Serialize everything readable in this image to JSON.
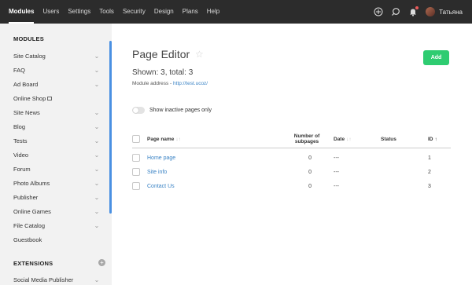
{
  "topnav": {
    "items": [
      "Modules",
      "Users",
      "Settings",
      "Tools",
      "Security",
      "Design",
      "Plans",
      "Help"
    ],
    "active_index": 0
  },
  "user": {
    "name": "Татьяна"
  },
  "icons": {
    "add": "plus-circle-icon",
    "search": "search-icon",
    "notifications": "bell-icon"
  },
  "sidebar": {
    "modules_title": "MODULES",
    "items": [
      {
        "label": "Site Catalog",
        "chevron": true
      },
      {
        "label": "FAQ",
        "chevron": true
      },
      {
        "label": "Ad Board",
        "chevron": true
      },
      {
        "label": "Online Shop",
        "chevron": false,
        "external": true
      },
      {
        "label": "Site News",
        "chevron": true
      },
      {
        "label": "Blog",
        "chevron": true
      },
      {
        "label": "Tests",
        "chevron": true
      },
      {
        "label": "Video",
        "chevron": true
      },
      {
        "label": "Forum",
        "chevron": true
      },
      {
        "label": "Photo Albums",
        "chevron": true
      },
      {
        "label": "Publisher",
        "chevron": true
      },
      {
        "label": "Online Games",
        "chevron": true
      },
      {
        "label": "File Catalog",
        "chevron": true
      },
      {
        "label": "Guestbook",
        "chevron": false
      }
    ],
    "extensions_title": "EXTENSIONS",
    "extensions_items": [
      {
        "label": "Social Media Publisher",
        "chevron": true
      }
    ]
  },
  "main": {
    "title": "Page Editor",
    "add_label": "Add",
    "shown_text": "Shown: 3, total: 3",
    "module_address_label": "Module address - ",
    "module_address_link": "http://test.ucoz/",
    "toggle_label": "Show inactive pages only",
    "toggle_on": false
  },
  "table": {
    "headers": {
      "name": "Page name",
      "subpages_line1": "Number of",
      "subpages_line2": "subpages",
      "date": "Date",
      "status": "Status",
      "id": "ID"
    },
    "rows": [
      {
        "name": "Home page",
        "subpages": "0",
        "date": "---",
        "status": "",
        "id": "1"
      },
      {
        "name": "Site info",
        "subpages": "0",
        "date": "---",
        "status": "",
        "id": "2"
      },
      {
        "name": "Contact Us",
        "subpages": "0",
        "date": "---",
        "status": "",
        "id": "3"
      }
    ]
  },
  "colors": {
    "topbar": "#2c2c2c",
    "sidebar": "#f2f2f2",
    "accent_green": "#2ecc71",
    "link_blue": "#3a83c5",
    "scroll_indicator": "#4a90e2"
  }
}
